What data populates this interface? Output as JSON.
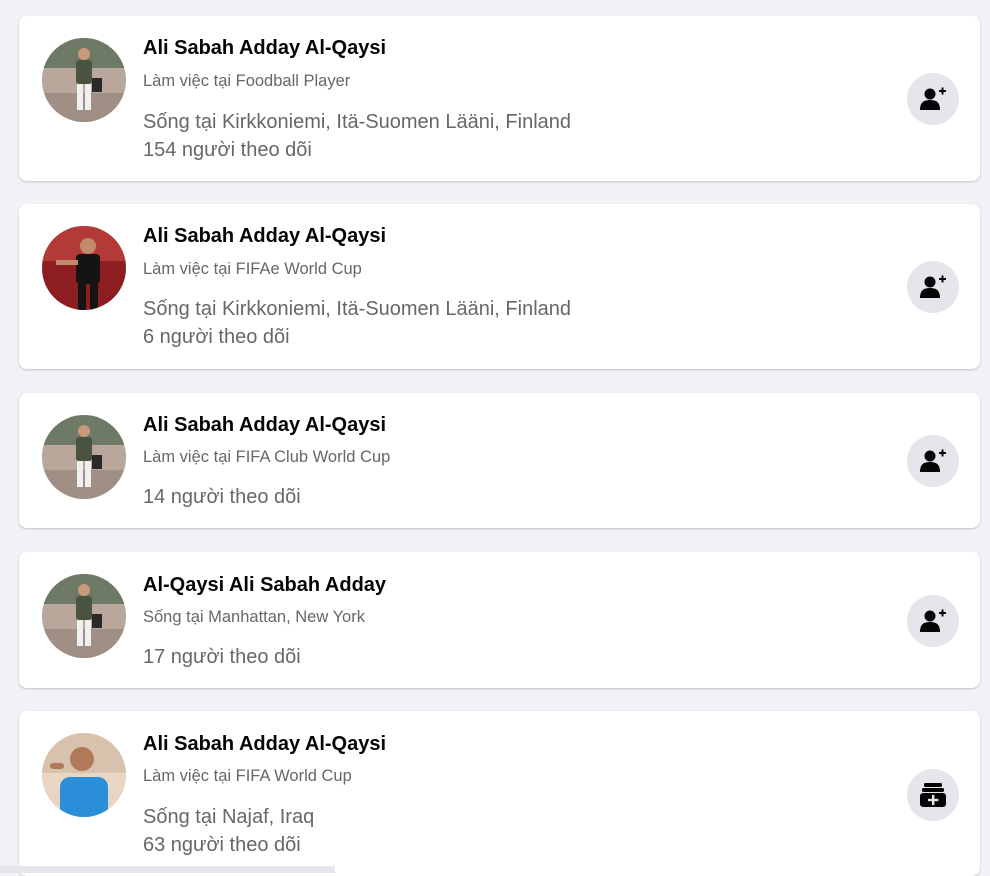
{
  "results": [
    {
      "name": "Ali Sabah Adday Al-Qaysi",
      "subtitle": "Làm việc tại Foodball Player",
      "location": "Sống tại Kirkkoniemi, Itä-Suomen Lääni, Finland",
      "followers": "154 người theo dõi",
      "action_icon": "add-friend-icon"
    },
    {
      "name": "Ali Sabah Adday Al-Qaysi",
      "subtitle": "Làm việc tại FIFAe World Cup",
      "location": "Sống tại Kirkkoniemi, Itä-Suomen Lääni, Finland",
      "followers": "6 người theo dõi",
      "action_icon": "add-friend-icon"
    },
    {
      "name": "Ali Sabah Adday Al-Qaysi",
      "subtitle": "Làm việc tại FIFA Club World Cup",
      "followers": "14 người theo dõi",
      "action_icon": "add-friend-icon"
    },
    {
      "name": "Al-Qaysi Ali Sabah Adday",
      "subtitle": "Sống tại Manhattan, New York",
      "followers": "17 người theo dõi",
      "action_icon": "add-friend-icon"
    },
    {
      "name": "Ali Sabah Adday Al-Qaysi",
      "subtitle": "Làm việc tại FIFA World Cup",
      "location": "Sống tại Najaf, Iraq",
      "followers": "63 người theo dõi",
      "action_icon": "follow-page-icon"
    }
  ],
  "colors": {
    "background": "#f0f2f5",
    "card": "#ffffff",
    "name_text": "#050505",
    "secondary_text": "#65676b",
    "button_bg": "#e4e6eb"
  }
}
